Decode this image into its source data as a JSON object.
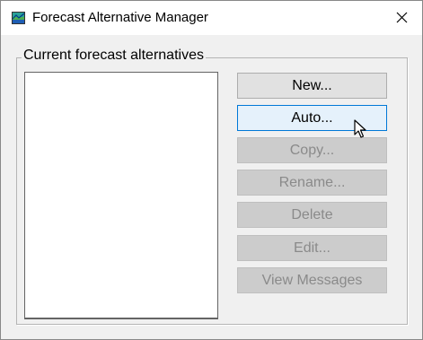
{
  "window": {
    "title": "Forecast Alternative Manager",
    "app_icon": "forecast-app-icon",
    "close_icon": "close-icon"
  },
  "group": {
    "label": "Current forecast alternatives"
  },
  "alternatives_list": {
    "items": []
  },
  "buttons": [
    {
      "label": "New...",
      "enabled": true,
      "focused": false
    },
    {
      "label": "Auto...",
      "enabled": true,
      "focused": true
    },
    {
      "label": "Copy...",
      "enabled": false,
      "focused": false
    },
    {
      "label": "Rename...",
      "enabled": false,
      "focused": false
    },
    {
      "label": "Delete",
      "enabled": false,
      "focused": false
    },
    {
      "label": "Edit...",
      "enabled": false,
      "focused": false
    },
    {
      "label": "View Messages",
      "enabled": false,
      "focused": false
    }
  ],
  "colors": {
    "focus_border": "#0078d7",
    "focus_fill": "#e5f1fb",
    "button_fill": "#e1e1e1",
    "disabled_fill": "#cccccc",
    "disabled_text": "#8a8a8a"
  },
  "cursor": "mouse-pointer-icon"
}
